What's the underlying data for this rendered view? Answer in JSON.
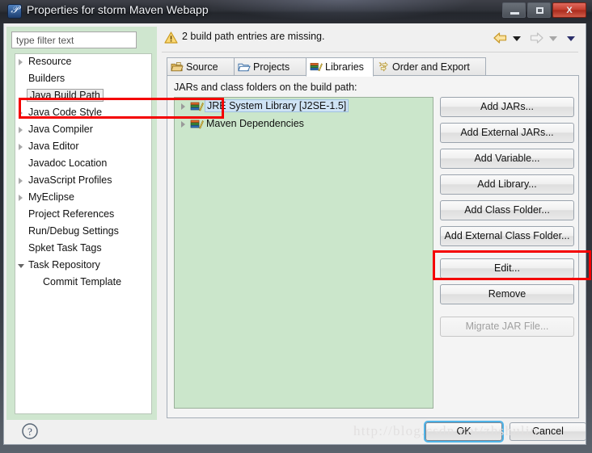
{
  "window": {
    "title": "Properties for storm Maven Webapp",
    "app_icon": "eclipse-icon",
    "controls": {
      "minimize": "minimize-button",
      "maximize": "maximize-button",
      "close_label": "X"
    }
  },
  "sidebar": {
    "filter_placeholder": "type filter text",
    "items": [
      {
        "label": "Resource",
        "expandable": true,
        "selected": false,
        "indent": false
      },
      {
        "label": "Builders",
        "expandable": false,
        "selected": false,
        "indent": false
      },
      {
        "label": "Java Build Path",
        "expandable": false,
        "selected": true,
        "indent": false
      },
      {
        "label": "Java Code Style",
        "expandable": true,
        "selected": false,
        "indent": false
      },
      {
        "label": "Java Compiler",
        "expandable": true,
        "selected": false,
        "indent": false
      },
      {
        "label": "Java Editor",
        "expandable": true,
        "selected": false,
        "indent": false
      },
      {
        "label": "Javadoc Location",
        "expandable": false,
        "selected": false,
        "indent": false
      },
      {
        "label": "JavaScript Profiles",
        "expandable": true,
        "selected": false,
        "indent": false
      },
      {
        "label": "MyEclipse",
        "expandable": true,
        "selected": false,
        "indent": false
      },
      {
        "label": "Project References",
        "expandable": false,
        "selected": false,
        "indent": false
      },
      {
        "label": "Run/Debug Settings",
        "expandable": false,
        "selected": false,
        "indent": false
      },
      {
        "label": "Spket Task Tags",
        "expandable": false,
        "selected": false,
        "indent": false
      },
      {
        "label": "Task Repository",
        "expandable": true,
        "expanded": true,
        "selected": false,
        "indent": false
      },
      {
        "label": "Commit Template",
        "expandable": false,
        "selected": false,
        "indent": true
      }
    ]
  },
  "message_bar": {
    "icon": "warning-icon",
    "text": "2 build path entries are missing.",
    "back_arrow": "back-arrow-icon",
    "forward_arrow": "forward-arrow-icon",
    "menu_caret": "chevron-down-icon"
  },
  "tabs": [
    {
      "label": "Source",
      "icon": "source-folder-icon",
      "active": false
    },
    {
      "label": "Projects",
      "icon": "open-folder-icon",
      "active": false
    },
    {
      "label": "Libraries",
      "icon": "library-books-icon",
      "active": true
    },
    {
      "label": "Order and Export",
      "icon": "order-export-icon",
      "active": false
    }
  ],
  "content": {
    "list_label": "JARs and class folders on the build path:",
    "entries": [
      {
        "label": "JRE System Library [J2SE-1.5]",
        "icon": "library-books-icon",
        "selected": true,
        "expandable": true
      },
      {
        "label": "Maven Dependencies",
        "icon": "library-books-icon",
        "selected": false,
        "expandable": true
      }
    ],
    "buttons": [
      {
        "label": "Add JARs...",
        "disabled": false,
        "highlighted": false
      },
      {
        "label": "Add External JARs...",
        "disabled": false,
        "highlighted": false
      },
      {
        "label": "Add Variable...",
        "disabled": false,
        "highlighted": false
      },
      {
        "label": "Add Library...",
        "disabled": false,
        "highlighted": false
      },
      {
        "label": "Add Class Folder...",
        "disabled": false,
        "highlighted": false
      },
      {
        "label": "Add External Class Folder...",
        "disabled": false,
        "highlighted": false
      },
      {
        "label": "Edit...",
        "disabled": false,
        "highlighted": true
      },
      {
        "label": "Remove",
        "disabled": false,
        "highlighted": false
      },
      {
        "label": "Migrate JAR File...",
        "disabled": true,
        "highlighted": false
      }
    ]
  },
  "footer": {
    "help_icon": "help-question-icon",
    "ok_label": "OK",
    "cancel_label": "Cancel"
  },
  "watermark": "http://blog.csdn.net/zhshulin",
  "colors": {
    "panel_green": "#cbe6cb",
    "annotation_red": "#f40000",
    "selection_blue": "#cfe3f5",
    "ok_focus_blue": "#4fb4e8"
  }
}
